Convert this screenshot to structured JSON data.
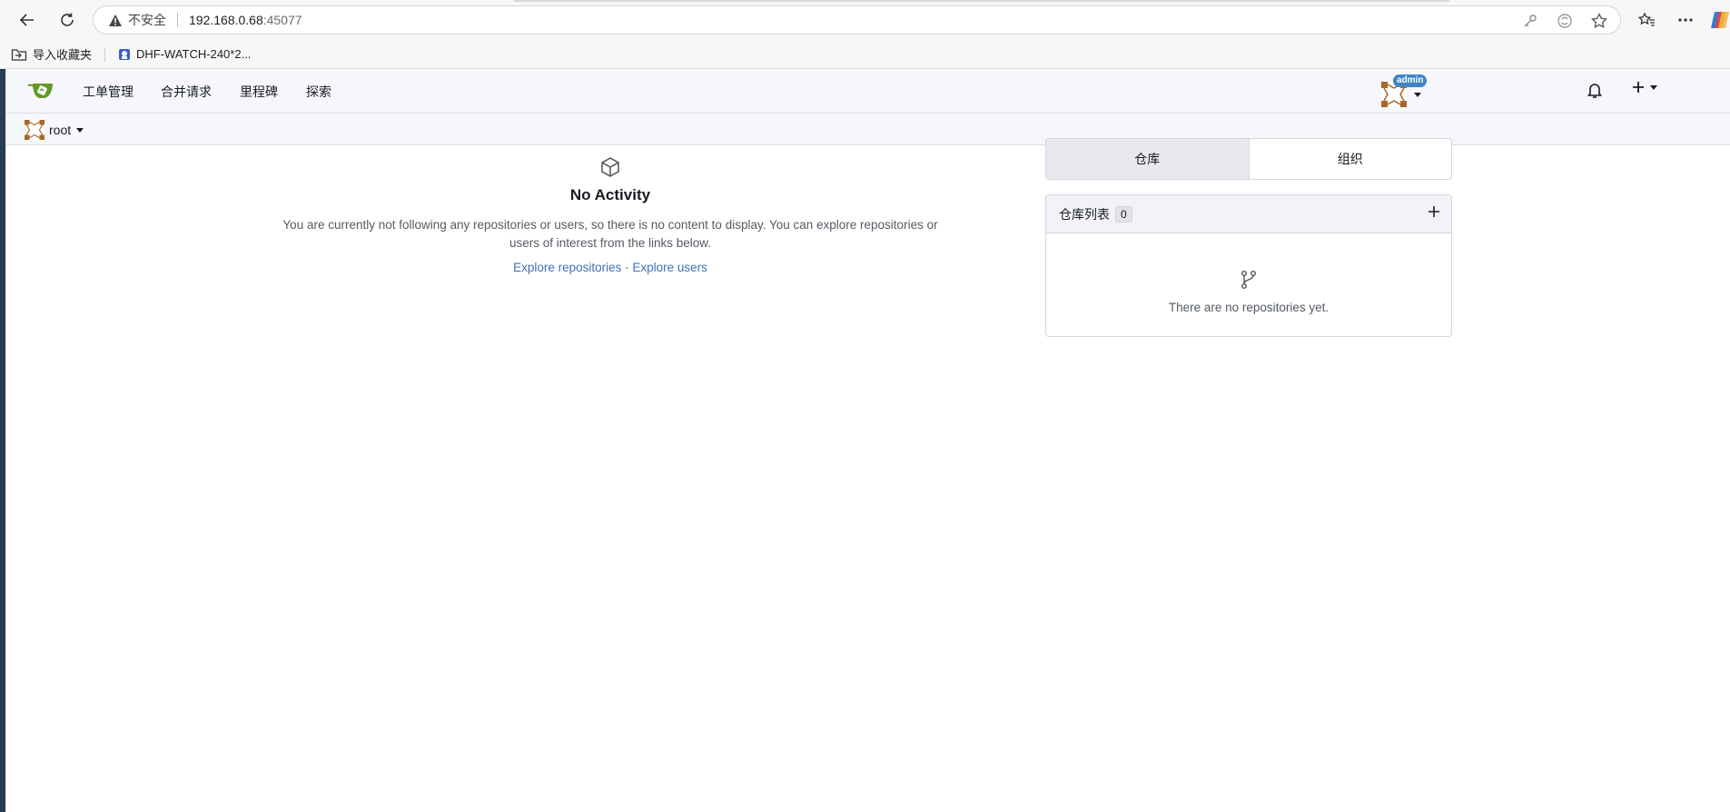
{
  "browser": {
    "address": {
      "insecure_label": "不安全",
      "host": "192.168.0.68",
      "port": ":45077"
    },
    "bookmarks": [
      {
        "label": "导入收藏夹"
      },
      {
        "label": "DHF-WATCH-240*2..."
      }
    ]
  },
  "nav": {
    "items": [
      {
        "label": "工单管理"
      },
      {
        "label": "合并请求"
      },
      {
        "label": "里程碑"
      },
      {
        "label": "探索"
      }
    ],
    "admin_badge": "admin"
  },
  "context": {
    "user": "root"
  },
  "activity": {
    "title": "No Activity",
    "description": "You are currently not following any repositories or users, so there is no content to display. You can explore repositories or users of interest from the links below.",
    "explore_repos": "Explore repositories",
    "separator": " · ",
    "explore_users": "Explore users"
  },
  "panel": {
    "tabs": [
      {
        "label": "仓库",
        "active": true
      },
      {
        "label": "组织",
        "active": false
      }
    ],
    "repo_list_title": "仓库列表",
    "repo_count": "0",
    "empty_text": "There are no repositories yet."
  }
}
